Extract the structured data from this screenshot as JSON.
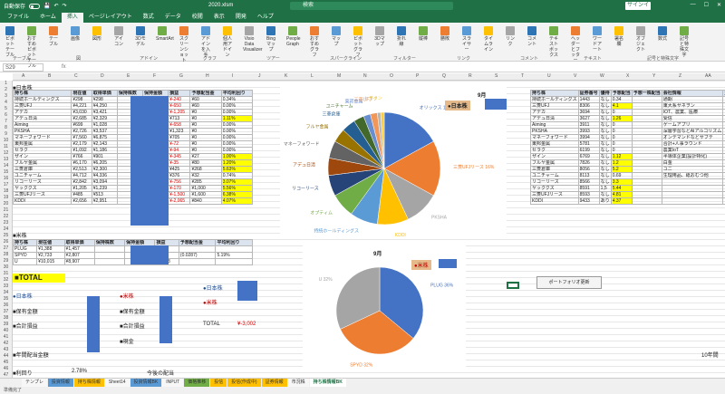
{
  "window": {
    "autosave": "自動保存",
    "file": "2020.xlsm",
    "search": "検索",
    "signin": "サインイン"
  },
  "menu": [
    "ファイル",
    "ホーム",
    "挿入",
    "ページレイアウト",
    "数式",
    "データ",
    "校閲",
    "表示",
    "開発",
    "ヘルプ"
  ],
  "ribbon": {
    "buttons": [
      "ピボットテーブル",
      "おすすめピボットテーブル",
      "テーブル",
      "画像",
      "図形",
      "アイコン",
      "3Dモデル",
      "SmartArt",
      "スクリーンショット",
      "アドインを入手",
      "個人用アドイン",
      "Visio Data Visualizer",
      "Bing マップ",
      "People Graph",
      "おすすめグラフ",
      "マップ",
      "ピボットグラフ",
      "3Dマップ",
      "折れ線",
      "縦棒",
      "勝敗",
      "スライサー",
      "タイムライン",
      "リンク",
      "コメント",
      "テキストボックス",
      "ヘッダーとフッター",
      "ワードアート",
      "署名欄",
      "オブジェクト",
      "数式",
      "記号と特殊文字"
    ],
    "groups": [
      "テーブル",
      "図",
      "アドイン",
      "グラフ",
      "ツアー",
      "スパークライン",
      "フィルター",
      "リンク",
      "コメント",
      "テキスト",
      "記号と特殊文字"
    ]
  },
  "namebox": "S29",
  "columns": [
    "A",
    "B",
    "C",
    "D",
    "E",
    "F",
    "G",
    "H",
    "I",
    "J",
    "K",
    "L",
    "M",
    "N",
    "O",
    "P",
    "Q",
    "R",
    "S",
    "T",
    "U",
    "V",
    "W",
    "X",
    "Y",
    "Z",
    "AA"
  ],
  "jp_table": {
    "title": "■日本株",
    "headers": [
      "持ち株",
      "現在値",
      "取得単価",
      "保持株数",
      "保持金額",
      "損益",
      "予想配当金",
      "平均利回り"
    ],
    "rows": [
      [
        "持続ホールディングス",
        "¥298",
        "¥298",
        "",
        "",
        "¥-240",
        "¥60",
        "0.34%"
      ],
      [
        "三菱UFJ",
        "¥4,221",
        "¥4,250",
        "",
        "",
        "¥-650",
        "¥60",
        "0.00%"
      ],
      [
        "アデカ",
        "¥3,030",
        "¥3,421",
        "",
        "",
        "¥-1,205",
        "¥0",
        "0.00%"
      ],
      [
        "アデュ日清",
        "¥2,685",
        "¥2,329",
        "",
        "",
        "¥713",
        "¥0",
        "1.11%"
      ],
      [
        "Aiming",
        "¥699",
        "¥1,028",
        "",
        "",
        "¥-658",
        "¥0",
        "0.00%"
      ],
      [
        "PKSHA",
        "¥2,726",
        "¥3,537",
        "",
        "",
        "¥1,323",
        "¥0",
        "0.00%"
      ],
      [
        "マネーフォワード",
        "¥7,560",
        "¥6,875",
        "",
        "",
        "¥705",
        "¥0",
        "0.00%"
      ],
      [
        "東邦金属",
        "¥2,179",
        "¥2,143",
        "",
        "",
        "¥-72",
        "¥0",
        "0.00%"
      ],
      [
        "セラク",
        "¥1,092",
        "¥1,186",
        "",
        "",
        "¥-94",
        "¥0",
        "0.00%"
      ],
      [
        "ザイン",
        "¥766",
        "¥901",
        "",
        "",
        "¥-345",
        "¥27",
        "1.00%"
      ],
      [
        "フルヤ金属",
        "¥6,170",
        "¥6,205",
        "",
        "",
        "¥-35",
        "¥80",
        "1.20%"
      ],
      [
        "三菱倉庫",
        "¥2,513",
        "¥2,300",
        "",
        "",
        "¥425",
        "¥268",
        "5.63%"
      ],
      [
        "ユニチャーム",
        "¥4,712",
        "¥4,336",
        "",
        "",
        "¥376",
        "¥32",
        "0.74%"
      ],
      [
        "リコーリース",
        "¥2,842",
        "¥3,094",
        "",
        "",
        "¥-756",
        "¥285",
        "3.07%"
      ],
      [
        "ヤッククス",
        "¥1,205",
        "¥1,239",
        "",
        "",
        "¥-170",
        "¥1,000",
        "5.56%"
      ],
      [
        "三菱UFJリース",
        "¥485",
        "¥513",
        "",
        "",
        "¥-1,500",
        "¥1,600",
        "6.38%"
      ],
      [
        "KDDI",
        "¥2,656",
        "¥2,951",
        "",
        "",
        "¥-2,065",
        "¥840",
        "4.07%"
      ]
    ]
  },
  "us_table": {
    "title": "■米株",
    "headers": [
      "持ち株",
      "現在値",
      "取得単価",
      "保持株数",
      "保持金額",
      "損益",
      "予想配当金",
      "平均利回り"
    ],
    "rows": [
      [
        "PLUG",
        "¥1,388",
        "¥1,457",
        "",
        "",
        "¥-480",
        "",
        ""
      ],
      [
        "SPYD",
        "¥2,733",
        "¥2,807",
        "",
        "",
        "¥-392",
        "(0.0287)",
        "5.19%"
      ],
      [
        "U",
        "¥10,015",
        "¥8,907",
        "",
        "",
        "¥1,108",
        "",
        ""
      ]
    ]
  },
  "summary": {
    "total": "■TOTAL",
    "jp_label": "●日本株",
    "us_label": "●米株",
    "holdings": "■保有金額",
    "pnl": "■合計損益",
    "pnl2": "■合計損益",
    "cash": "■現金",
    "yearly_div": "■年間配当金額",
    "total_label": "TOTAL",
    "total_value": "¥-3,002",
    "yield": "2.78%",
    "outlook": "今後の配当",
    "row_label": "■利回り"
  },
  "right_table": {
    "headers": [
      "持ち株",
      "証券番号",
      "優待",
      "予想配当",
      "予想一株配当",
      "会社情報",
      "更新日"
    ],
    "update_date": "2020/9/11",
    "rows": [
      [
        "持続ホールディングス",
        "1443",
        "なし",
        "0.34",
        "",
        "通期",
        ""
      ],
      [
        "三菱UFJ",
        "8306",
        "なし",
        "4.1",
        "",
        "東大系サネヲン",
        ""
      ],
      [
        "アデカ",
        "3694",
        "なし",
        "0",
        "",
        "IOT、農業、医療",
        ""
      ],
      [
        "アデュ日清",
        "3627",
        "なし",
        "1.26",
        "",
        "受信",
        ""
      ],
      [
        "Aiming",
        "3911",
        "なし",
        "0",
        "",
        "ゲームアプリ",
        ""
      ],
      [
        "PKSHA",
        "3993",
        "なし",
        "0",
        "",
        "深層学習などAIアルゴリズム",
        ""
      ],
      [
        "マネーフォワード",
        "3994",
        "なし",
        "0",
        "",
        "オンデマンドなどサブテ",
        ""
      ],
      [
        "東邦金属",
        "5781",
        "なし",
        "0",
        "",
        "合計+人事ラウンド",
        ""
      ],
      [
        "セラク",
        "6199",
        "なし",
        "0",
        "",
        "農業IoT",
        ""
      ],
      [
        "ザイン",
        "6769",
        "なし",
        "1.12",
        "",
        "半導体企業(設計特化)",
        ""
      ],
      [
        "フルヤ金属",
        "7826",
        "なし",
        "1.2",
        "",
        "白金",
        ""
      ],
      [
        "三菱倉庫",
        "8056",
        "なし",
        "5.2",
        "",
        "ユニ",
        ""
      ],
      [
        "ユニチャーム",
        "8113",
        "なし",
        "0.69",
        "",
        "生理用品、紙おむつ他",
        ""
      ],
      [
        "リコーリース",
        "8566",
        "なし",
        "3.3",
        "",
        "",
        ""
      ],
      [
        "ヤッククス",
        "8591",
        "1,5",
        "5.44",
        "",
        "",
        ""
      ],
      [
        "三菱UFJリース",
        "8593",
        "なし",
        "4.81",
        "",
        "",
        ""
      ],
      [
        "KDDI",
        "9433",
        "あり",
        "4.37",
        "",
        "",
        ""
      ]
    ]
  },
  "pie1": {
    "title": "9月",
    "subtitle": "●日本株",
    "slices": [
      {
        "label": "オリックス",
        "pct": "17%",
        "value": 17,
        "color": "#4472c4"
      },
      {
        "label": "三菱UFJリース",
        "pct": "16%",
        "value": 16,
        "color": "#ed7d31"
      },
      {
        "label": "PKSHA",
        "pct": "",
        "value": 10,
        "color": "#a5a5a5"
      },
      {
        "label": "KDDI",
        "pct": "",
        "value": 9,
        "color": "#ffc000"
      },
      {
        "label": "持続ホールディングス",
        "pct": "",
        "value": 8,
        "color": "#5b9bd5"
      },
      {
        "label": "オプティム",
        "pct": "",
        "value": 7,
        "color": "#70ad47"
      },
      {
        "label": "リコーリース",
        "pct": "",
        "value": 6,
        "color": "#264478"
      },
      {
        "label": "アデュ日清",
        "pct": "",
        "value": 5,
        "color": "#9e480e"
      },
      {
        "label": "マネーフォワード",
        "pct": "",
        "value": 5,
        "color": "#636363"
      },
      {
        "label": "フルヤ金属",
        "pct": "",
        "value": 4,
        "color": "#997300"
      },
      {
        "label": "三菱倉庫",
        "pct": "",
        "value": 4,
        "color": "#255e91"
      },
      {
        "label": "ユニチャーム",
        "pct": "",
        "value": 3,
        "color": "#43682b"
      },
      {
        "label": "東邦金属",
        "pct": "",
        "value": 2,
        "color": "#698ed0"
      },
      {
        "label": "三菱UFJ",
        "pct": "",
        "value": 2,
        "color": "#f1975a"
      },
      {
        "label": "セラク",
        "pct": "",
        "value": 1,
        "color": "#b7b7b7"
      },
      {
        "label": "ザイン",
        "pct": "",
        "value": 1,
        "color": "#ffcd33"
      },
      {
        "label": "Aiming",
        "pct": "",
        "value": 0,
        "color": "#7cafdd"
      }
    ]
  },
  "pie2": {
    "title": "9月",
    "subtitle": "●米株",
    "slices": [
      {
        "label": "PLUG",
        "pct": "36%",
        "value": 36,
        "color": "#4472c4"
      },
      {
        "label": "SPYD",
        "pct": "32%",
        "value": 32,
        "color": "#ed7d31"
      },
      {
        "label": "U",
        "pct": "32%",
        "value": 32,
        "color": "#a5a5a5"
      }
    ]
  },
  "button": "ポートフォリオ更新",
  "side_note": "10年間",
  "sheet_tabs": [
    "テンプレ",
    "投資情報",
    "持ち株情報",
    "Sheet14",
    "投資情報BK",
    "INPUT",
    "価格推移",
    "投信",
    "投信(作成中)",
    "証券情報",
    "市況株",
    "持ち株情報BK"
  ],
  "status": "準備完了"
}
